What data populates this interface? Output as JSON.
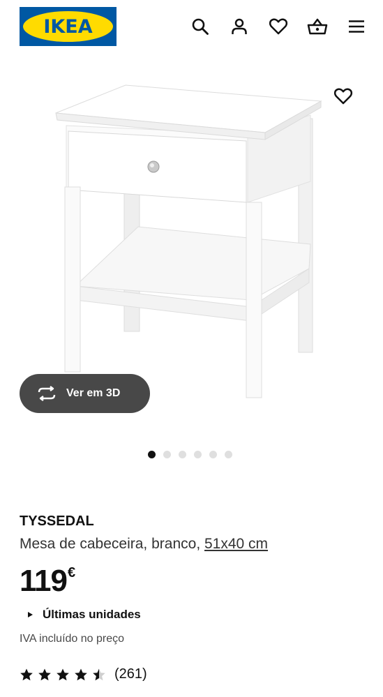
{
  "header": {
    "logo_text": "IKEA",
    "icons": [
      "search-icon",
      "user-icon",
      "heart-icon",
      "basket-icon",
      "menu-icon"
    ]
  },
  "gallery": {
    "view3d_label": "Ver em 3D",
    "dot_count": 6,
    "active_index": 0
  },
  "product": {
    "name": "TYSSEDAL",
    "description": "Mesa de cabeceira, branco, ",
    "dimensions": "51x40 cm",
    "price": "119",
    "currency": "€",
    "stock": "Últimas unidades",
    "vat_note": "IVA incluído no preço",
    "rating_value": 4.5,
    "review_count": "(261)"
  },
  "colors": {
    "brand_blue": "#0058a3",
    "brand_yellow": "#ffdb00",
    "dark_button": "#484848"
  }
}
